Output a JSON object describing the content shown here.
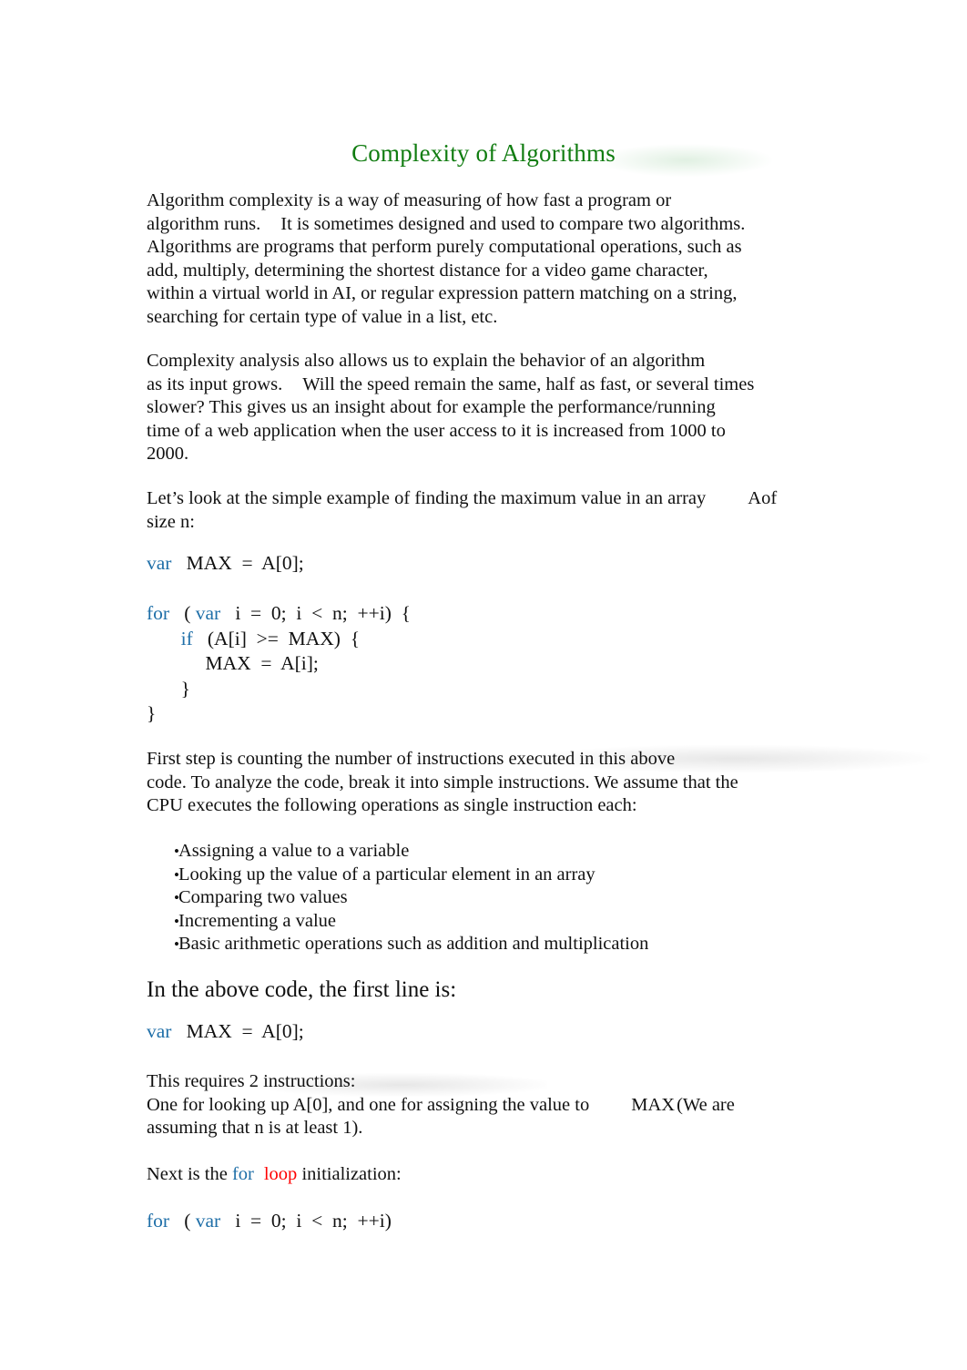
{
  "document": {
    "title": "Complexity of Algorithms",
    "title_color": "#107C10",
    "keyword_color": "#1F6FA8",
    "loop_keyword_color": "#FF0000",
    "body_color": "#111111",
    "background": "#ffffff"
  },
  "paragraphs": {
    "intro": {
      "line1": "Algorithm complexity is a way of measuring of how fast a program or",
      "line2a": "algorithm runs.",
      "line2b": "It is sometimes designed and used to compare two algorithms.",
      "line3": "Algorithms are programs that perform purely computational operations, such as",
      "line4": "add, multiply, determining the shortest distance for a video game character,",
      "line5": "within a virtual world in AI, or regular expression pattern matching on a string,",
      "line6": "searching for certain type of value in a list, etc."
    },
    "analysis": {
      "line1": "Complexity analysis also allows us to explain the behavior of an algorithm",
      "line2a": "as its input grows.",
      "line2b": "Will the speed remain the same, half as fast, or several times",
      "line3": "slower? This gives us an insight about for example the performance/running",
      "line4": "time of a web application when the user access to it is increased from 1000 to",
      "line5": "2000."
    },
    "example_intro": {
      "line1a": "Let’s look at the simple example of finding the maximum value in an array",
      "line1b": "A",
      "line1c": "of",
      "line2a": "size ",
      "line2b": "n",
      "line2c": ":"
    },
    "counting": {
      "line1": "First step is counting the number of instructions executed in this above",
      "line2": "code.  To analyze the code, break it into simple instructions. We assume that the",
      "line3": "CPU executes the following operations as single instruction each:"
    },
    "requires": {
      "line1": "This requires 2 instructions:",
      "line2a": "One for looking up A[0], and one for assigning the value to",
      "line2b": "MAX",
      "line2c": "(We are",
      "line3": "assuming that n is at least 1)."
    },
    "next_is_the": {
      "prefix": "Next is the ",
      "kw_for": "for",
      "kw_loop": "loop",
      "suffix": " initialization:"
    }
  },
  "headings": {
    "first_line": "In the above code, the first line is:"
  },
  "code_blocks": {
    "main": {
      "line1_kw": "var",
      "line1_rest": "   MAX  =  A[0];",
      "line2_kw": "for",
      "line2_mid": "   ( ",
      "line2_kw2": "var",
      "line2_rest": "   i  =  0;  i  <  n;  ++i)  {",
      "line3_indent": "       ",
      "line3_kw": "if",
      "line3_rest": "   (A[i]  >=  MAX)  {",
      "line4": "            MAX  =  A[i];",
      "line5": "       }",
      "line6": "}"
    },
    "first_line": {
      "kw": "var",
      "rest": "   MAX  =  A[0];"
    },
    "for_init": {
      "kw": "for",
      "mid": "   ( ",
      "kw2": "var",
      "rest": "   i  =  0;  i  <  n;  ++i)"
    }
  },
  "bullets": {
    "marker": "•",
    "items": [
      "Assigning a value to a variable",
      "Looking up the value of a particular element in an array",
      "Comparing two values",
      "Incrementing a value",
      "Basic arithmetic operations such as addition and multiplication"
    ]
  }
}
